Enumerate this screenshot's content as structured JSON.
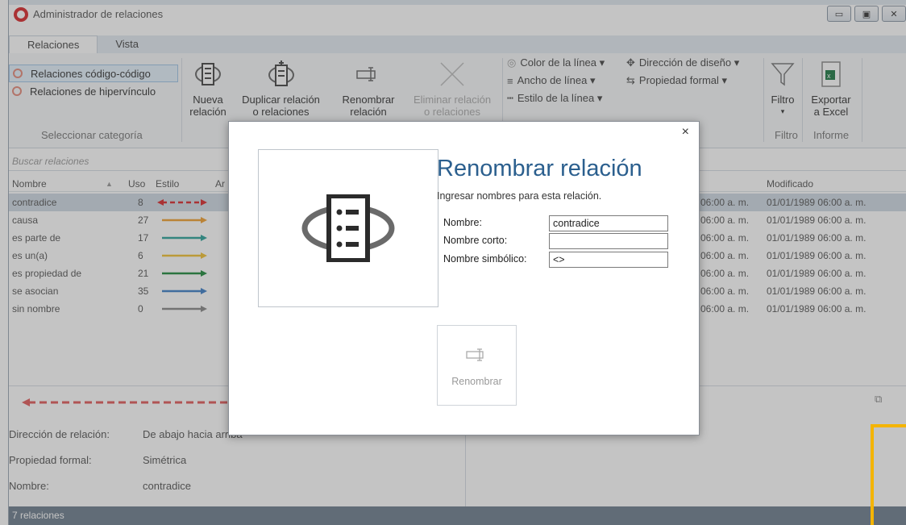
{
  "window": {
    "title": "Administrador de relaciones"
  },
  "tabs": [
    "Relaciones",
    "Vista"
  ],
  "ribbon": {
    "categories": [
      "Relaciones código-código",
      "Relaciones de hipervínculo"
    ],
    "category_group_label": "Seleccionar categoría",
    "new_line1": "Nueva",
    "new_line2": "relación",
    "dup_line1": "Duplicar relación",
    "dup_line2": "o relaciones",
    "ren_line1": "Renombrar",
    "ren_line2": "relación",
    "del_line1": "Eliminar relación",
    "del_line2": "o relaciones",
    "line_color": "Color de la línea ▾",
    "line_width": "Ancho de línea ▾",
    "line_style": "Estilo de la línea ▾",
    "design_dir": "Dirección de diseño ▾",
    "formal_prop": "Propiedad formal ▾",
    "filter_label": "Filtro",
    "filter_arrow": "▾",
    "filter_group": "Filtro",
    "export_line1": "Exportar",
    "export_line2": "a Excel",
    "report_group": "Informe"
  },
  "search": {
    "placeholder": "Buscar relaciones"
  },
  "grid": {
    "headers": {
      "name": "Nombre",
      "use": "Uso",
      "style": "Estilo",
      "ar": "Ar",
      "modified": "Modificado"
    },
    "rows": [
      {
        "name": "contradice",
        "use": "8",
        "color": "#d9282b",
        "dashed": true,
        "time": "06:00 a. m.",
        "modified": "01/01/1989 06:00 a. m."
      },
      {
        "name": "causa",
        "use": "27",
        "color": "#f0a030",
        "dashed": false,
        "time": "06:00 a. m.",
        "modified": "01/01/1989 06:00 a. m."
      },
      {
        "name": "es parte de",
        "use": "17",
        "color": "#2aa39a",
        "dashed": false,
        "time": "06:00 a. m.",
        "modified": "01/01/1989 06:00 a. m."
      },
      {
        "name": "es un(a)",
        "use": "6",
        "color": "#f2c233",
        "dashed": false,
        "time": "06:00 a. m.",
        "modified": "01/01/1989 06:00 a. m."
      },
      {
        "name": "es propiedad de",
        "use": "21",
        "color": "#1e8a3c",
        "dashed": false,
        "time": "06:00 a. m.",
        "modified": "01/01/1989 06:00 a. m."
      },
      {
        "name": "se asocian",
        "use": "35",
        "color": "#3d7fc8",
        "dashed": false,
        "time": "06:00 a. m.",
        "modified": "01/01/1989 06:00 a. m."
      },
      {
        "name": "sin nombre",
        "use": "0",
        "color": "#888888",
        "dashed": false,
        "time": "06:00 a. m.",
        "modified": "01/01/1989 06:00 a. m."
      }
    ]
  },
  "detail": {
    "dir_label": "Dirección de relación:",
    "dir_value": "De abajo hacia arriba",
    "prop_label": "Propiedad formal:",
    "prop_value": "Simétrica",
    "name_label": "Nombre:",
    "name_value": "contradice"
  },
  "status": {
    "text": "7 relaciones"
  },
  "dialog": {
    "title": "Renombrar relación",
    "subtitle": "Ingresar nombres para esta relación.",
    "close": "×",
    "name_label": "Nombre:",
    "name_value": "contradice",
    "short_label": "Nombre corto:",
    "short_value": "",
    "symbolic_label": "Nombre simbólico:",
    "symbolic_value": "<>",
    "rename_button": "Renombrar"
  }
}
